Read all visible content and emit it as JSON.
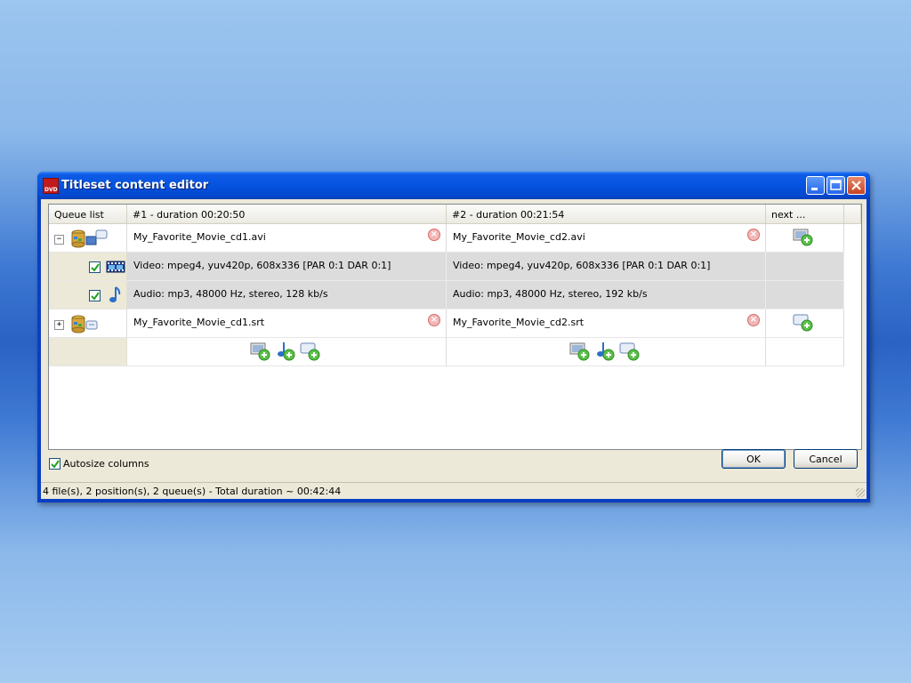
{
  "window": {
    "title": "Titleset content editor",
    "app_icon_text": "DVD"
  },
  "grid": {
    "headers": [
      "Queue list",
      "#1 - duration 00:20:50",
      "#2 - duration 00:21:54",
      "next ..."
    ],
    "video_queue": {
      "file1": "My_Favorite_Movie_cd1.avi",
      "file2": "My_Favorite_Movie_cd2.avi",
      "video1": "Video: mpeg4, yuv420p, 608x336 [PAR 0:1 DAR 0:1]",
      "video2": "Video: mpeg4, yuv420p, 608x336 [PAR 0:1 DAR 0:1]",
      "audio1": "Audio: mp3, 48000 Hz, stereo, 128 kb/s",
      "audio2": "Audio: mp3, 48000 Hz, stereo, 192 kb/s",
      "expander": "−"
    },
    "subtitle_queue": {
      "file1": "My_Favorite_Movie_cd1.srt",
      "file2": "My_Favorite_Movie_cd2.srt",
      "expander": "+"
    }
  },
  "options": {
    "autosize_label": "Autosize columns",
    "autosize_checked": true
  },
  "buttons": {
    "ok": "OK",
    "cancel": "Cancel"
  },
  "status": "4 file(s), 2 position(s), 2 queue(s) - Total duration ~ 00:42:44",
  "colors": {
    "titlebar": "#0553e0",
    "client": "#ece9d8",
    "row_gray": "#dcdcdc",
    "check": "#21a121"
  },
  "icons": {
    "queue": "database-stack-icon",
    "video": "film-strip-icon",
    "audio": "music-note-icon",
    "subtitle": "subtitle-bubble-icon",
    "delete": "delete-circle-icon",
    "add_video": "add-video-icon",
    "add_audio": "add-audio-icon",
    "add_subtitle": "add-subtitle-icon"
  }
}
